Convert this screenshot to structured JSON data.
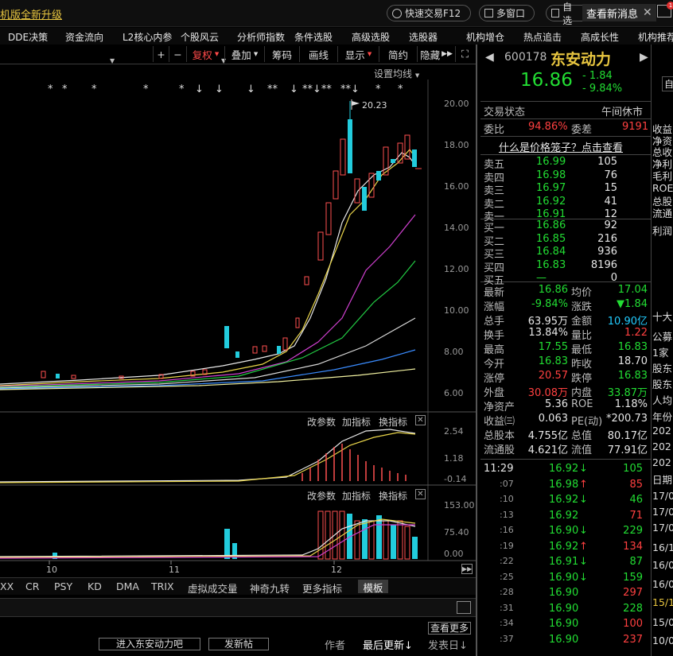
{
  "topbar": {
    "banner": "机版全新升级",
    "quick_trade": "快速交易F12",
    "multi_window": "多窗口",
    "self_select": "自选",
    "new_msg": "查看新消息",
    "mail_badge": "1"
  },
  "menu": [
    "DDE决策",
    "资金流向",
    "L2核心内参",
    "个股风云",
    "分析师指数",
    "条件选股",
    "高级选股",
    "选股器",
    "机构增仓",
    "热点追击",
    "高成长性",
    "机构推荐"
  ],
  "toolbar": {
    "plus": "+",
    "minus": "−",
    "fuquan": "复权",
    "overlay": "叠加",
    "chips": "筹码",
    "draw": "画线",
    "show": "显示",
    "simple": "简约",
    "hide": "隐藏"
  },
  "chart": {
    "set_ma": "设置均线",
    "ticks": [
      "20.00",
      "18.00",
      "16.00",
      "14.00",
      "12.00",
      "10.00",
      "8.00",
      "6.00"
    ],
    "high_flag": "20.23",
    "macd_ticks": [
      "2.54",
      "1.18",
      "-0.14"
    ],
    "vol_ticks": [
      "153.00",
      "75.40",
      "0.00"
    ],
    "panel_links": [
      "改参数",
      "加指标",
      "换指标"
    ],
    "months": [
      "10",
      "11",
      "12"
    ],
    "indicators": [
      "XX",
      "CR",
      "PSY",
      "KD",
      "DMA",
      "TRIX",
      "虚拟成交量",
      "神奇九转",
      "更多指标",
      "模板"
    ],
    "forum": {
      "go_bar": "进入东安动力吧",
      "post": "发新帖",
      "view_more": "查看更多",
      "author": "作者",
      "last_update": "最后更新↓",
      "post_time": "发表日↓"
    }
  },
  "stock": {
    "code": "600178",
    "name": "东安动力",
    "price": "16.86",
    "change": "- 1.84",
    "change_pct": "- 9.84%",
    "status_label": "交易状态",
    "status": "午间休市",
    "wb_label": "委比",
    "wb": "94.86%",
    "wc_label": "委差",
    "wc": "9191",
    "cage_link": "什么是价格笼子？点击查看",
    "asks": [
      {
        "l": "卖五",
        "p": "16.99",
        "v": "105"
      },
      {
        "l": "卖四",
        "p": "16.98",
        "v": "76"
      },
      {
        "l": "卖三",
        "p": "16.97",
        "v": "15"
      },
      {
        "l": "卖二",
        "p": "16.92",
        "v": "41"
      },
      {
        "l": "卖一",
        "p": "16.91",
        "v": "12"
      }
    ],
    "bids": [
      {
        "l": "买一",
        "p": "16.86",
        "v": "92"
      },
      {
        "l": "买二",
        "p": "16.85",
        "v": "216"
      },
      {
        "l": "买三",
        "p": "16.84",
        "v": "936"
      },
      {
        "l": "买四",
        "p": "16.83",
        "v": "8196"
      },
      {
        "l": "买五",
        "p": "—",
        "v": "0"
      }
    ],
    "stats": [
      {
        "l1": "最新",
        "v1": "16.86",
        "c1": "green",
        "l2": "均价",
        "v2": "17.04",
        "c2": "green"
      },
      {
        "l1": "涨幅",
        "v1": "-9.84%",
        "c1": "green",
        "l2": "涨跌",
        "v2": "▼1.84",
        "c2": "green"
      },
      {
        "l1": "总手",
        "v1": "63.95万",
        "c1": "white",
        "l2": "金额",
        "v2": "10.90亿",
        "c2": "cyan"
      },
      {
        "l1": "换手",
        "v1": "13.84%",
        "c1": "white",
        "l2": "量比",
        "v2": "1.22",
        "c2": "red"
      },
      {
        "l1": "最高",
        "v1": "17.55",
        "c1": "green",
        "l2": "最低",
        "v2": "16.83",
        "c2": "green"
      },
      {
        "l1": "今开",
        "v1": "16.83",
        "c1": "green",
        "l2": "昨收",
        "v2": "18.70",
        "c2": "white"
      },
      {
        "l1": "涨停",
        "v1": "20.57",
        "c1": "red",
        "l2": "跌停",
        "v2": "16.83",
        "c2": "green"
      },
      {
        "l1": "外盘",
        "v1": "30.08万",
        "c1": "red",
        "l2": "内盘",
        "v2": "33.87万",
        "c2": "green"
      },
      {
        "l1": "净资产",
        "v1": "5.36",
        "c1": "white",
        "l2": "ROE",
        "v2": "1.18%",
        "c2": "white"
      },
      {
        "l1": "收益㈢",
        "v1": "0.063",
        "c1": "white",
        "l2": "PE(动)",
        "v2": "*200.73",
        "c2": "white"
      },
      {
        "l1": "总股本",
        "v1": "4.755亿",
        "c1": "white",
        "l2": "总值",
        "v2": "80.17亿",
        "c2": "white"
      },
      {
        "l1": "流通股",
        "v1": "4.621亿",
        "c1": "white",
        "l2": "流值",
        "v2": "77.91亿",
        "c2": "white"
      }
    ],
    "ticks": [
      {
        "t": "11:29",
        "p": "16.92",
        "a": "↓",
        "v": "105",
        "vc": "green"
      },
      {
        "t": ":07",
        "p": "16.98",
        "a": "↑",
        "v": "85",
        "vc": "red"
      },
      {
        "t": ":10",
        "p": "16.92",
        "a": "↓",
        "v": "46",
        "vc": "green"
      },
      {
        "t": ":13",
        "p": "16.92",
        "a": "",
        "v": "71",
        "vc": "red"
      },
      {
        "t": ":16",
        "p": "16.90",
        "a": "↓",
        "v": "229",
        "vc": "green"
      },
      {
        "t": ":19",
        "p": "16.92",
        "a": "↑",
        "v": "134",
        "vc": "red"
      },
      {
        "t": ":22",
        "p": "16.91",
        "a": "↓",
        "v": "87",
        "vc": "green"
      },
      {
        "t": ":25",
        "p": "16.90",
        "a": "↓",
        "v": "159",
        "vc": "green"
      },
      {
        "t": ":28",
        "p": "16.90",
        "a": "",
        "v": "297",
        "vc": "red"
      },
      {
        "t": ":31",
        "p": "16.90",
        "a": "",
        "v": "228",
        "vc": "green"
      },
      {
        "t": ":34",
        "p": "16.90",
        "a": "",
        "v": "100",
        "vc": "red"
      },
      {
        "t": ":37",
        "p": "16.90",
        "a": "",
        "v": "237",
        "vc": "red"
      }
    ]
  },
  "farright": {
    "top": "自",
    "rows": [
      "收益",
      "净资",
      "总收",
      "净利",
      "毛利",
      "ROE",
      "总股",
      "流通",
      "利润",
      "十大",
      "公募",
      "1家",
      "股东",
      "股东",
      "人均",
      "年份",
      "202",
      "202",
      "202",
      "日期",
      "17/0",
      "17/0",
      "17/0",
      "16/1",
      "16/0",
      "16/0",
      "15/1",
      "15/0",
      "10/0",
      "12/0"
    ]
  }
}
